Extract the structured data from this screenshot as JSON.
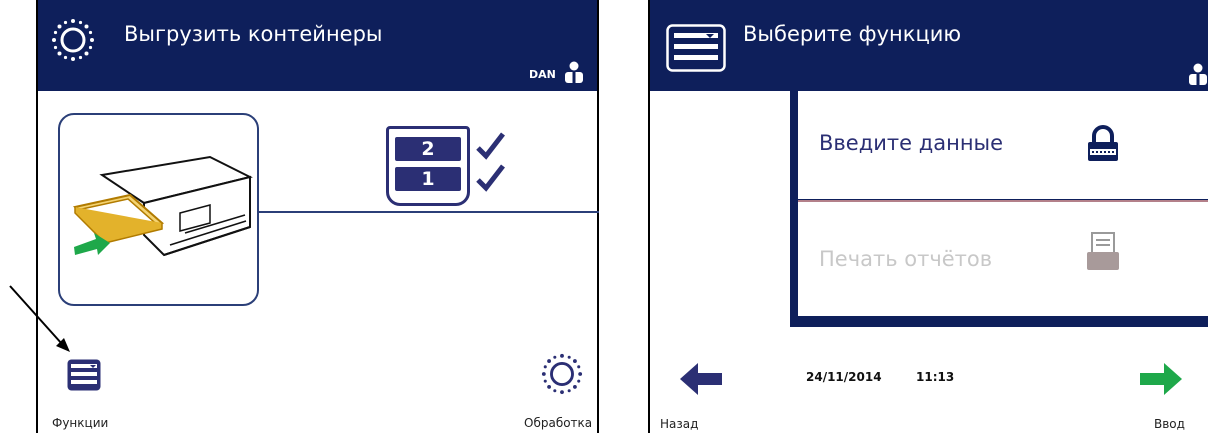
{
  "left_screen": {
    "title": "Выгрузить контейнеры",
    "user": "DAN",
    "containers": [
      "2",
      "1"
    ],
    "functions_label": "Функции",
    "process_label": "Обработка"
  },
  "right_screen": {
    "title": "Выберите функцию",
    "menu": [
      {
        "label": "Введите данные",
        "icon": "lock-icon",
        "enabled": true
      },
      {
        "label": "Печать отчётов",
        "icon": "printer-icon",
        "enabled": false
      }
    ],
    "date": "24/11/2014",
    "time": "11:13",
    "back_label": "Назад",
    "enter_label": "Ввод"
  },
  "colors": {
    "header": "#0e1f5b",
    "accent": "#2b2f74",
    "green": "#1ea84a",
    "tray": "#e3b22b"
  }
}
